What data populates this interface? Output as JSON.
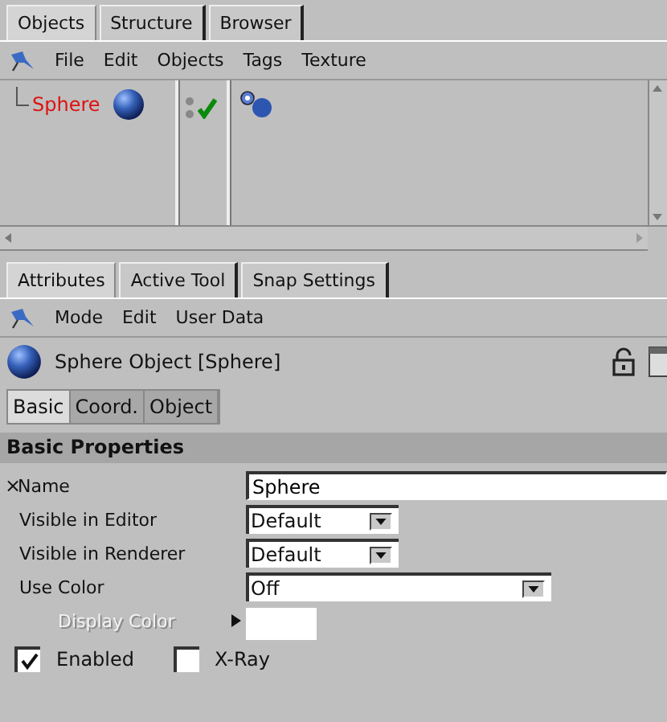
{
  "object_manager": {
    "tabs": [
      {
        "label": "Objects",
        "selected": true
      },
      {
        "label": "Structure",
        "selected": false
      },
      {
        "label": "Browser",
        "selected": false
      }
    ],
    "menu": [
      "File",
      "Edit",
      "Objects",
      "Tags",
      "Texture"
    ],
    "objects": [
      {
        "name": "Sphere",
        "selected": true,
        "enabled": true
      }
    ]
  },
  "attribute_manager": {
    "tabs": [
      {
        "label": "Attributes",
        "selected": true
      },
      {
        "label": "Active Tool",
        "selected": false
      },
      {
        "label": "Snap Settings",
        "selected": false
      }
    ],
    "menu": [
      "Mode",
      "Edit",
      "User Data"
    ],
    "title": "Sphere Object [Sphere]",
    "subtabs": [
      {
        "label": "Basic",
        "selected": true
      },
      {
        "label": "Coord.",
        "selected": false
      },
      {
        "label": "Object",
        "selected": false
      }
    ],
    "section": "Basic Properties",
    "fields": [
      {
        "kind": "text",
        "mark": "×",
        "label": "Name",
        "value": "Sphere"
      },
      {
        "kind": "select",
        "label": "Visible in Editor",
        "value": "Default"
      },
      {
        "kind": "select",
        "label": "Visible in Renderer",
        "value": "Default"
      },
      {
        "kind": "wide-select",
        "label": "Use Color",
        "value": "Off"
      },
      {
        "kind": "color",
        "label": "Display Color",
        "disabled": true
      },
      {
        "kind": "checkboxes",
        "items": [
          {
            "label": "Enabled",
            "checked": true
          },
          {
            "label": "X-Ray",
            "checked": false
          }
        ]
      }
    ]
  }
}
